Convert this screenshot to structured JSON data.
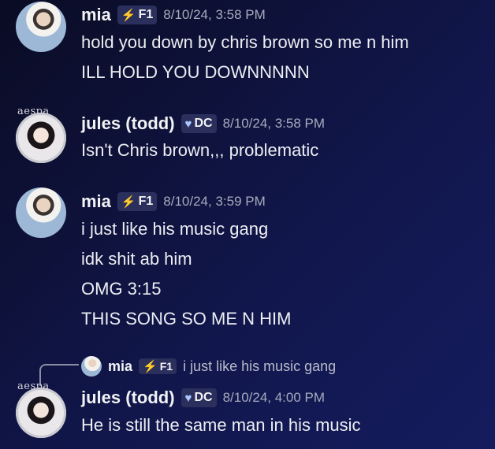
{
  "messages": [
    {
      "author": "mia",
      "tag": {
        "icon": "bolt-icon",
        "label": "F1"
      },
      "timestamp": "8/10/24, 3:58 PM",
      "lines": [
        "hold you down by chris brown so me n him",
        "ILL HOLD YOU DOWNNNNN"
      ]
    },
    {
      "author": "jules (todd)",
      "deco": "aespa",
      "tag": {
        "icon": "heart-icon",
        "label": "DC"
      },
      "timestamp": "8/10/24, 3:58 PM",
      "lines": [
        "Isn't Chris brown,,, problematic"
      ]
    },
    {
      "author": "mia",
      "tag": {
        "icon": "bolt-icon",
        "label": "F1"
      },
      "timestamp": "8/10/24, 3:59 PM",
      "lines": [
        "i just like his music gang",
        "idk shit ab him",
        "OMG 3:15",
        "THIS SONG SO ME N HIM"
      ]
    },
    {
      "author": "jules (todd)",
      "deco": "aespa",
      "tag": {
        "icon": "heart-icon",
        "label": "DC"
      },
      "timestamp": "8/10/24, 4:00 PM",
      "reply_to": {
        "author": "mia",
        "tag": "F1",
        "text": "i just like his music gang"
      },
      "lines": [
        "He is still the same man in his music"
      ]
    }
  ]
}
